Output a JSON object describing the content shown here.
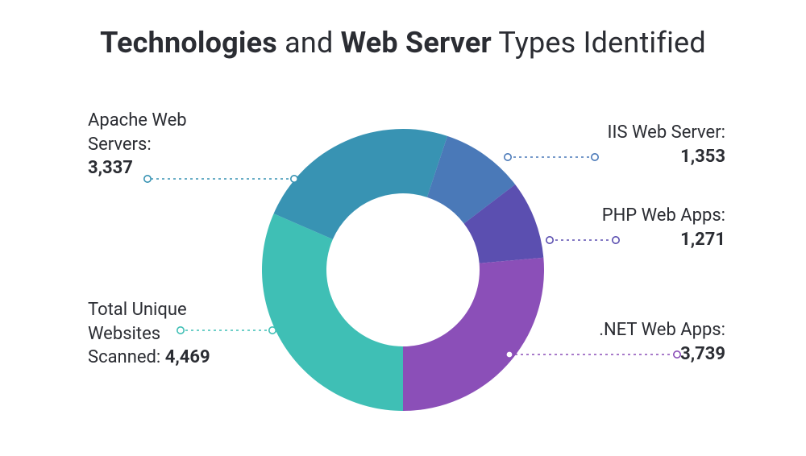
{
  "title": {
    "parts": [
      "Technologies",
      " and ",
      "Web Server",
      " Types Identified"
    ],
    "bold": [
      true,
      false,
      true,
      false
    ]
  },
  "chart_data": {
    "type": "pie",
    "title": "Technologies and Web Server Types Identified",
    "series": [
      {
        "name": "Total Unique Websites Scanned",
        "value": 4469,
        "label_prefix": "Total Unique\nWebsites\nScanned: ",
        "color": "#3fbfb5"
      },
      {
        "name": "Apache Web Servers",
        "value": 3337,
        "label_prefix": "Apache Web\nServers:\n",
        "color": "#3893b3"
      },
      {
        "name": "IIS Web Server",
        "value": 1353,
        "label_prefix": "IIS Web Server:\n",
        "color": "#4a79b8"
      },
      {
        "name": "PHP Web Apps",
        "value": 1271,
        "label_prefix": "PHP Web Apps:\n",
        "color": "#5b4fb0"
      },
      {
        "name": ".NET Web Apps",
        "value": 3739,
        "label_prefix": ".NET Web Apps:\n",
        "color": "#8b4fb8"
      }
    ]
  },
  "labels": {
    "apache_name": "Apache Web Servers:",
    "apache_val": "3,337",
    "iis_name": "IIS Web Server:",
    "iis_val": "1,353",
    "php_name": "PHP Web Apps:",
    "php_val": "1,271",
    "net_name": ".NET Web Apps:",
    "net_val": "3,739",
    "total_line1": "Total Unique",
    "total_line2": "Websites",
    "total_line3_prefix": "Scanned: ",
    "total_val": "4,469"
  }
}
